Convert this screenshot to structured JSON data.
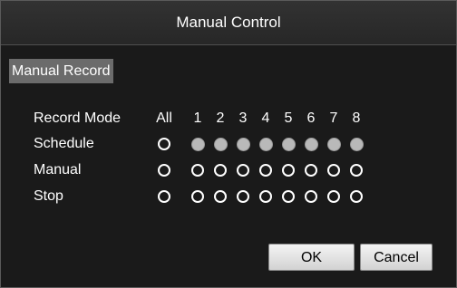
{
  "window": {
    "title": "Manual Control"
  },
  "tab": {
    "label": "Manual Record"
  },
  "grid": {
    "row_labels": {
      "header": "Record Mode",
      "schedule": "Schedule",
      "manual": "Manual",
      "stop": "Stop"
    },
    "columns": [
      "All",
      "1",
      "2",
      "3",
      "4",
      "5",
      "6",
      "7",
      "8"
    ],
    "selection": {
      "All": "none",
      "1": "Schedule",
      "2": "Schedule",
      "3": "Schedule",
      "4": "Schedule",
      "5": "Schedule",
      "6": "Schedule",
      "7": "Schedule",
      "8": "Schedule"
    }
  },
  "buttons": {
    "ok": "OK",
    "cancel": "Cancel"
  },
  "colors": {
    "background": "#1a1a1a",
    "titlebar": "#2c2c2c",
    "tab_background": "#6b6b6b",
    "radio_selected": "#b9b9b9",
    "text": "#ffffff"
  }
}
